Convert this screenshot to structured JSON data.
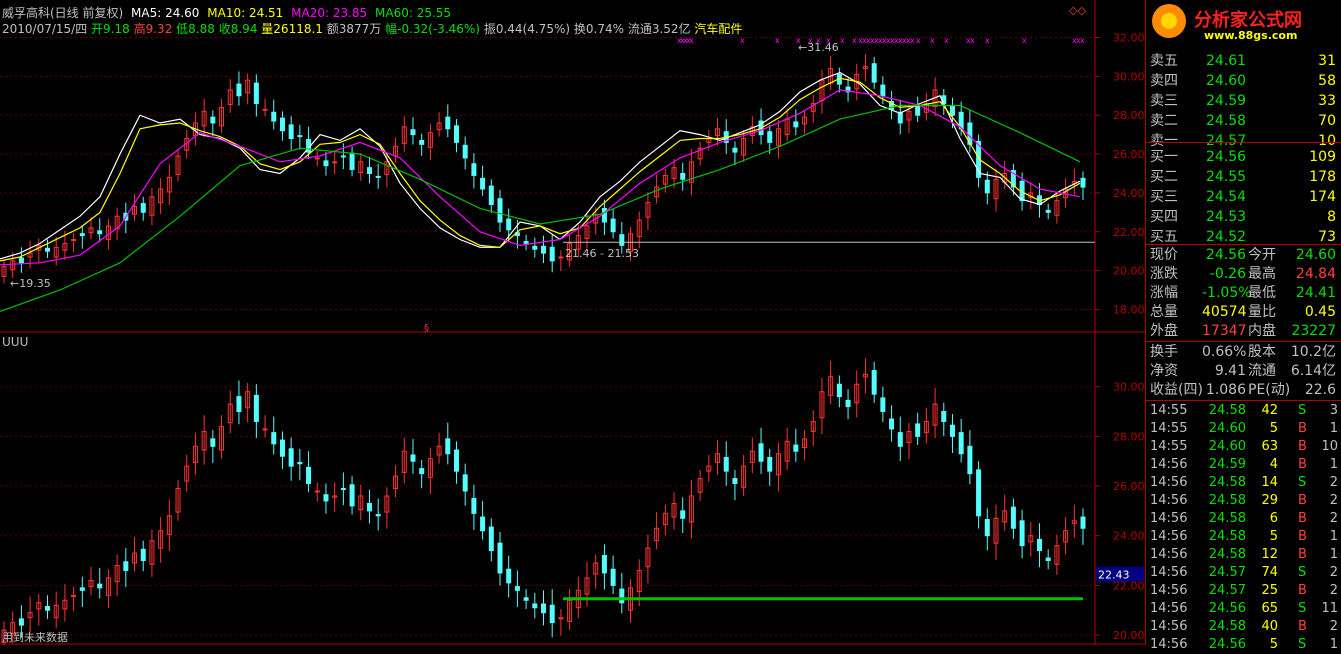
{
  "header": {
    "stock_name": "威孚高科(日线 前复权)",
    "ma5": "MA5: 24.60",
    "ma10": "MA10: 24.51",
    "ma20": "MA20: 23.85",
    "ma60": "MA60: 25.55",
    "date": "2010/07/15/四",
    "open": "开9.18",
    "high": "高9.32",
    "low": "低8.88",
    "close": "收8.94",
    "volume": "量26118.1",
    "amount": "额3877万",
    "change": "幅-0.32(-3.46%)",
    "amplitude": "振0.44(4.75%)",
    "turnover": "换0.74%",
    "float": "流通3.52亿",
    "sector": "汽车配件",
    "lower_title": "UUU",
    "footer_note": "用到未来数据"
  },
  "logo": {
    "text": "分析家公式网",
    "url": "www.88gs.com"
  },
  "colors": {
    "up": "#ff3232",
    "down": "#54ffff",
    "ma5": "#ffffff",
    "ma10": "#ffff00",
    "ma20": "#ff00ff",
    "ma60": "#00c000",
    "green_text": "#00e000",
    "red_text": "#ff4040",
    "yellow_text": "#ffff00",
    "frame": "#b00000"
  },
  "chart_data": {
    "type": "line",
    "title": "威孚高科(日线 前复权)",
    "upper": {
      "ylim": [
        17.2,
        32.9
      ],
      "yticks": [
        "18.00",
        "20.00",
        "22.00",
        "24.00",
        "26.00",
        "28.00",
        "30.00",
        "32.00"
      ],
      "annotations": {
        "low_label": "19.35",
        "high_label": "31.46",
        "range_label": "21.46 - 21.53"
      },
      "series": [
        {
          "name": "MA5",
          "x": [
            0,
            20,
            40,
            60,
            80,
            100,
            120,
            140,
            160,
            180,
            200,
            220,
            240,
            260,
            280,
            300,
            320,
            340,
            360,
            380,
            400,
            420,
            440,
            460,
            480,
            500,
            520,
            540,
            560,
            580,
            600,
            620,
            640,
            660,
            680,
            700,
            720,
            740,
            760,
            780,
            800,
            820,
            840,
            860,
            880,
            900,
            920,
            940,
            960,
            980,
            1000,
            1020,
            1040,
            1060,
            1080
          ],
          "values": [
            20.6,
            20.9,
            21.4,
            22.1,
            22.8,
            23.8,
            26.0,
            28.0,
            27.6,
            27.8,
            27.0,
            26.8,
            26.3,
            25.2,
            25.0,
            25.8,
            27.0,
            26.7,
            27.3,
            26.4,
            24.5,
            23.2,
            22.2,
            21.6,
            21.2,
            21.2,
            22.5,
            22.3,
            21.6,
            22.5,
            23.8,
            24.6,
            25.6,
            26.4,
            27.2,
            27.0,
            26.7,
            27.1,
            27.5,
            28.2,
            29.2,
            29.8,
            30.2,
            29.6,
            28.5,
            28.1,
            28.6,
            29.0,
            26.8,
            25.0,
            24.8,
            23.7,
            23.4,
            24.1,
            24.6
          ]
        },
        {
          "name": "MA10",
          "x": [
            0,
            20,
            40,
            60,
            80,
            100,
            120,
            140,
            160,
            180,
            200,
            220,
            240,
            260,
            280,
            300,
            320,
            340,
            360,
            380,
            400,
            420,
            440,
            460,
            480,
            500,
            520,
            540,
            560,
            580,
            600,
            620,
            640,
            660,
            680,
            700,
            720,
            740,
            760,
            780,
            800,
            820,
            840,
            860,
            880,
            900,
            920,
            940,
            960,
            980,
            1000,
            1020,
            1040,
            1060,
            1080
          ],
          "values": [
            20.5,
            20.7,
            21.2,
            21.7,
            22.2,
            23.0,
            25.0,
            27.3,
            27.5,
            27.6,
            27.2,
            26.9,
            26.4,
            25.5,
            25.2,
            25.6,
            26.5,
            26.6,
            27.0,
            26.5,
            25.0,
            23.6,
            22.6,
            21.8,
            21.3,
            21.2,
            22.1,
            22.3,
            21.9,
            22.2,
            23.3,
            24.2,
            25.1,
            25.9,
            26.7,
            26.8,
            26.8,
            27.0,
            27.3,
            27.9,
            28.8,
            29.4,
            29.9,
            29.7,
            28.9,
            28.4,
            28.5,
            28.7,
            27.4,
            25.7,
            25.0,
            24.1,
            23.6,
            23.9,
            24.5
          ]
        },
        {
          "name": "MA20",
          "x": [
            0,
            40,
            80,
            120,
            160,
            200,
            240,
            280,
            320,
            360,
            400,
            440,
            480,
            520,
            560,
            600,
            640,
            680,
            720,
            760,
            800,
            840,
            880,
            920,
            960,
            1000,
            1040,
            1080
          ],
          "values": [
            20.3,
            20.4,
            20.8,
            22.3,
            25.5,
            27.1,
            26.4,
            25.6,
            25.9,
            26.6,
            25.8,
            23.8,
            22.0,
            21.3,
            21.6,
            22.8,
            24.5,
            25.8,
            26.6,
            27.2,
            28.1,
            29.3,
            29.0,
            28.5,
            27.4,
            25.4,
            24.2,
            23.8
          ]
        },
        {
          "name": "MA60",
          "x": [
            0,
            60,
            120,
            180,
            240,
            300,
            360,
            420,
            480,
            540,
            600,
            660,
            720,
            780,
            840,
            900,
            960,
            1020,
            1080
          ],
          "values": [
            17.9,
            19.0,
            20.4,
            22.8,
            25.4,
            26.3,
            26.0,
            24.7,
            23.2,
            22.4,
            22.9,
            24.2,
            25.2,
            26.4,
            27.8,
            28.5,
            28.5,
            27.1,
            25.6
          ]
        }
      ]
    },
    "lower": {
      "ylim": [
        19.8,
        31.8
      ],
      "yticks": [
        "20.00",
        "22.00",
        "24.00",
        "26.00",
        "28.00",
        "30.00"
      ],
      "marker_label": "22.43",
      "support_line": {
        "value": 21.46,
        "x_start": 563,
        "x_end": 1083
      }
    },
    "candles_close": [
      20.2,
      20.5,
      20.4,
      20.9,
      21.3,
      21.0,
      21.2,
      21.4,
      21.6,
      21.8,
      22.2,
      21.9,
      22.3,
      22.8,
      22.6,
      23.3,
      23.0,
      23.8,
      24.2,
      24.8,
      25.9,
      26.8,
      27.6,
      28.2,
      27.6,
      28.4,
      29.3,
      29.0,
      29.8,
      28.6,
      28.3,
      27.7,
      27.2,
      26.8,
      26.9,
      26.1,
      25.8,
      25.4,
      25.6,
      25.9,
      25.2,
      25.6,
      25.0,
      24.8,
      25.6,
      26.4,
      27.4,
      27.0,
      26.5,
      27.1,
      27.6,
      27.3,
      26.6,
      25.8,
      24.9,
      24.2,
      23.4,
      22.5,
      22.1,
      21.8,
      21.4,
      21.1,
      20.9,
      20.5,
      20.7,
      21.4,
      21.8,
      22.3,
      22.9,
      22.5,
      22.0,
      21.3,
      21.9,
      22.6,
      23.5,
      24.3,
      24.9,
      25.3,
      24.7,
      25.6,
      26.3,
      26.8,
      27.3,
      26.6,
      26.1,
      26.8,
      27.4,
      27.0,
      26.6,
      27.3,
      27.8,
      27.4,
      27.9,
      28.6,
      29.8,
      30.4,
      29.6,
      29.2,
      30.1,
      30.5,
      29.7,
      29.0,
      28.3,
      27.6,
      28.2,
      28.0,
      28.6,
      29.3,
      28.6,
      28.0,
      27.3,
      26.5,
      24.8,
      24.0,
      24.7,
      25.0,
      24.3,
      23.6,
      24.0,
      23.4,
      23.0,
      23.6,
      24.2,
      24.6,
      24.3
    ]
  },
  "orderbook": {
    "sell": [
      {
        "label": "卖五",
        "price": "24.61",
        "vol": "31"
      },
      {
        "label": "卖四",
        "price": "24.60",
        "vol": "58"
      },
      {
        "label": "卖三",
        "price": "24.59",
        "vol": "33"
      },
      {
        "label": "卖二",
        "price": "24.58",
        "vol": "70"
      },
      {
        "label": "卖一",
        "price": "24.57",
        "vol": "10"
      }
    ],
    "buy": [
      {
        "label": "买一",
        "price": "24.56",
        "vol": "109"
      },
      {
        "label": "买二",
        "price": "24.55",
        "vol": "178"
      },
      {
        "label": "买三",
        "price": "24.54",
        "vol": "174"
      },
      {
        "label": "买四",
        "price": "24.53",
        "vol": "8"
      },
      {
        "label": "买五",
        "price": "24.52",
        "vol": "73"
      }
    ]
  },
  "quote": [
    {
      "l1": "现价",
      "v1": "24.56",
      "c1": "#00e000",
      "l2": "今开",
      "v2": "24.60",
      "c2": "#00e000"
    },
    {
      "l1": "涨跌",
      "v1": "-0.26",
      "c1": "#00e000",
      "l2": "最高",
      "v2": "24.84",
      "c2": "#ff4040"
    },
    {
      "l1": "涨幅",
      "v1": "-1.05%",
      "c1": "#00e000",
      "l2": "最低",
      "v2": "24.41",
      "c2": "#00e000"
    },
    {
      "l1": "总量",
      "v1": "40574",
      "c1": "#ffff00",
      "l2": "量比",
      "v2": "0.45",
      "c2": "#ffff00"
    },
    {
      "l1": "外盘",
      "v1": "17347",
      "c1": "#ff4040",
      "l2": "内盘",
      "v2": "23227",
      "c2": "#00e000"
    }
  ],
  "fundamentals": [
    {
      "l1": "换手",
      "v1": "0.66%",
      "l2": "股本",
      "v2": "10.2亿"
    },
    {
      "l1": "净资",
      "v1": "9.41",
      "l2": "流通",
      "v2": "6.14亿"
    },
    {
      "l1": "收益(四)",
      "v1": "1.086",
      "l2": "PE(动)",
      "v2": "22.6"
    }
  ],
  "ticks": [
    {
      "time": "14:55",
      "price": "24.58",
      "vol": "42",
      "dir": "S",
      "n": "3"
    },
    {
      "time": "14:55",
      "price": "24.60",
      "vol": "5",
      "dir": "B",
      "n": "1"
    },
    {
      "time": "14:55",
      "price": "24.60",
      "vol": "63",
      "dir": "B",
      "n": "10"
    },
    {
      "time": "14:56",
      "price": "24.59",
      "vol": "4",
      "dir": "B",
      "n": "1"
    },
    {
      "time": "14:56",
      "price": "24.58",
      "vol": "14",
      "dir": "S",
      "n": "2"
    },
    {
      "time": "14:56",
      "price": "24.58",
      "vol": "29",
      "dir": "B",
      "n": "2"
    },
    {
      "time": "14:56",
      "price": "24.58",
      "vol": "6",
      "dir": "B",
      "n": "2"
    },
    {
      "time": "14:56",
      "price": "24.58",
      "vol": "5",
      "dir": "B",
      "n": "1"
    },
    {
      "time": "14:56",
      "price": "24.58",
      "vol": "12",
      "dir": "B",
      "n": "1"
    },
    {
      "time": "14:56",
      "price": "24.57",
      "vol": "74",
      "dir": "S",
      "n": "2"
    },
    {
      "time": "14:56",
      "price": "24.57",
      "vol": "25",
      "dir": "B",
      "n": "2"
    },
    {
      "time": "14:56",
      "price": "24.56",
      "vol": "65",
      "dir": "S",
      "n": "11"
    },
    {
      "time": "14:56",
      "price": "24.58",
      "vol": "40",
      "dir": "B",
      "n": "2"
    },
    {
      "time": "14:56",
      "price": "24.56",
      "vol": "5",
      "dir": "S",
      "n": "1"
    }
  ]
}
